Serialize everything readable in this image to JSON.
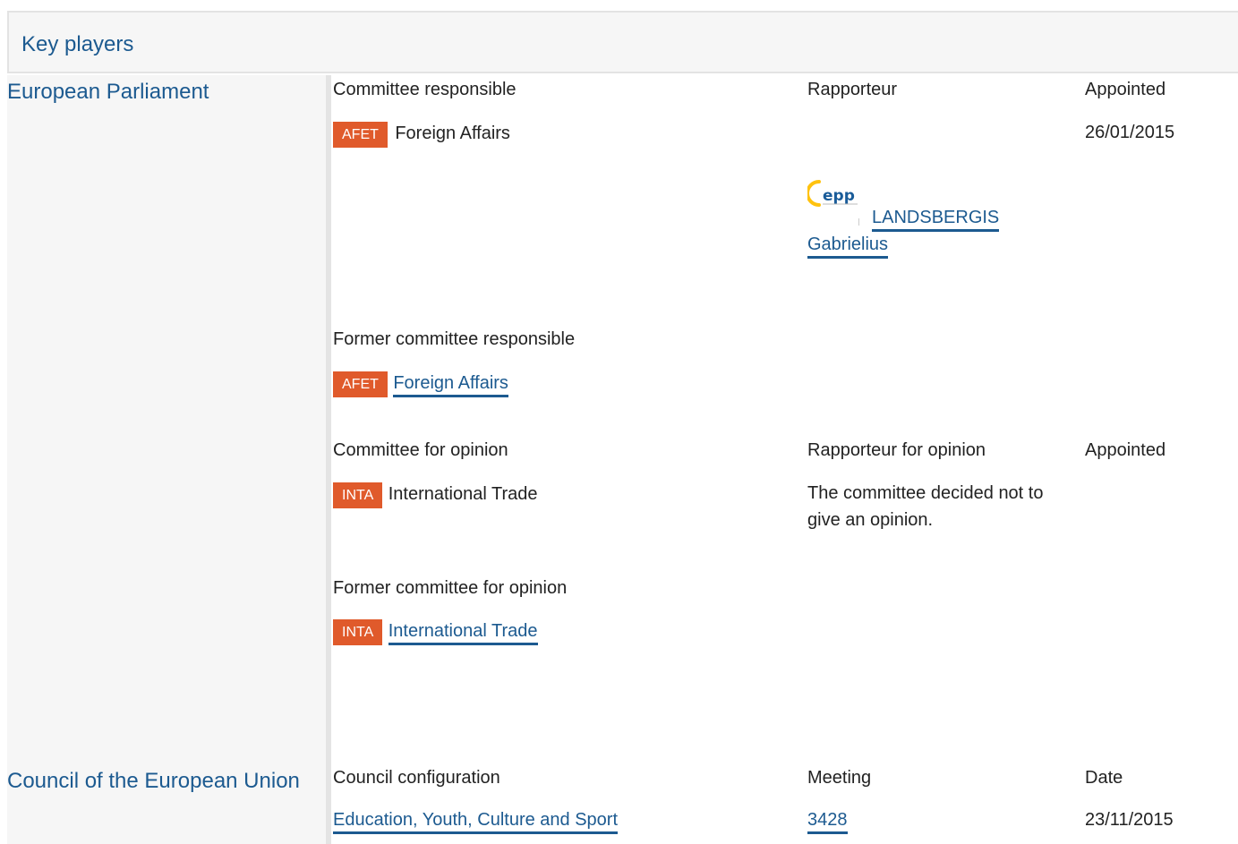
{
  "header": {
    "title": "Key players"
  },
  "european_parliament": {
    "name": "European Parliament",
    "committee_responsible": {
      "heading": "Committee responsible",
      "rapporteur_heading": "Rapporteur",
      "appointed_heading": "Appointed",
      "code": "AFET",
      "committee": "Foreign Affairs",
      "appointed": "26/01/2015",
      "rapporteur_group_logo": "epp-logo",
      "rapporteur_first_line": "LANDSBERGIS",
      "rapporteur_second_line": "Gabrielius"
    },
    "former_committee_responsible": {
      "heading": "Former committee responsible",
      "code": "AFET",
      "committee": "Foreign Affairs"
    },
    "committee_for_opinion": {
      "heading": "Committee for opinion",
      "rapporteur_heading": "Rapporteur for opinion",
      "appointed_heading": "Appointed",
      "code": "INTA",
      "committee": "International Trade",
      "note_line1": "The committee decided not to",
      "note_line2": "give an opinion."
    },
    "former_committee_for_opinion": {
      "heading": "Former committee for opinion",
      "code": "INTA",
      "committee": "International Trade"
    }
  },
  "council": {
    "name": "Council of the European Union",
    "configuration_heading": "Council configuration",
    "meeting_heading": "Meeting",
    "date_heading": "Date",
    "configuration": "Education, Youth, Culture and Sport",
    "meeting": "3428",
    "date": "23/11/2015"
  },
  "colors": {
    "link_blue": "#1c5a90",
    "badge_orange": "#e05a2b",
    "panel_grey": "#f6f6f6"
  }
}
